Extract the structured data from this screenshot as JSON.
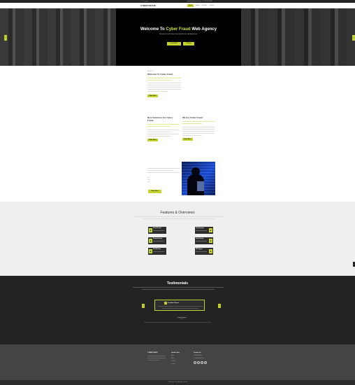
{
  "topbar": {
    "social_icons": [
      "facebook-icon",
      "twitter-icon",
      "linkedin-icon",
      "instagram-icon",
      "youtube-icon"
    ],
    "contact": "info@cyberfraud.com  |  +1 234 567 8900"
  },
  "navbar": {
    "brand": "CYBER FRAUD",
    "items": [
      "Home",
      "About",
      "Services",
      "Contact"
    ]
  },
  "hero": {
    "title_prefix": "Welcome To ",
    "title_highlight": "Cyber Fraud",
    "title_suffix": " Web Agency",
    "subtitle": "We protect your business from cyber threats and digital fraud",
    "btn_primary": "Learn More",
    "btn_secondary": "Contact"
  },
  "about": {
    "eyebrow": "About Us",
    "title": "Welcome To Cyber Fraud",
    "btn": "Read More"
  },
  "solutions": {
    "title": "Best Solutions For Cyber Fraud",
    "btn": "Read More"
  },
  "who": {
    "title": "We Are Cyber Fraud",
    "btn": "Read More"
  },
  "video": {
    "btn": "Read More"
  },
  "features": {
    "title": "Features & Overviews",
    "cards_left": [
      "Fraud Detection",
      "Network Security",
      "Data Recovery"
    ],
    "cards_right": [
      "Threat Analysis",
      "Cloud Security",
      "24/7 Support"
    ]
  },
  "testimonials": {
    "title": "Testimonials",
    "client_name": "Jonathan Bryant",
    "client_role": "Client"
  },
  "footer": {
    "brand": "CYBER FRAUD",
    "links_title": "Useful Links",
    "links": [
      "Home",
      "About",
      "Services",
      "Contact"
    ],
    "contact_title": "Contact Us",
    "phone": "+1 234 567 8900",
    "email": "info@cyberfraud.com",
    "copyright": "© 2023 Cyber Fraud. All rights reserved."
  },
  "colors": {
    "accent": "#c6d22e",
    "dark": "#232323",
    "footer_bg": "#444444",
    "features_bg": "#efefef"
  }
}
